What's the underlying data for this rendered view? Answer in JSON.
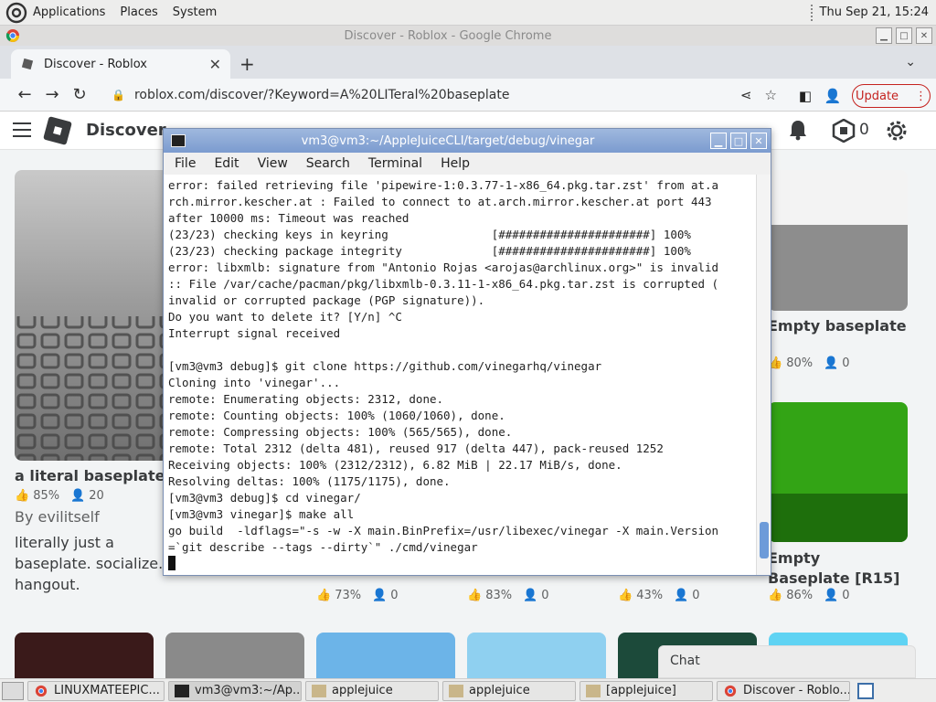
{
  "top_panel": {
    "menus": [
      "Applications",
      "Places",
      "System"
    ],
    "clock": "Thu Sep 21, 15:24"
  },
  "chrome": {
    "window_title": "Discover - Roblox - Google Chrome",
    "tab_title": "Discover - Roblox",
    "url": "roblox.com/discover/?Keyword=A%20LITeral%20baseplate",
    "update_label": "Update"
  },
  "roblox": {
    "header_title": "Discover",
    "robux_count": "0",
    "cards": [
      {
        "title": "a literal baseplate.",
        "likes": "85%",
        "players": "20",
        "creator": "By evilitself",
        "description": "literally just a baseplate. socialize. hangout."
      },
      {
        "title": "Empty baseplate",
        "likes": "80%",
        "players": "0"
      },
      {
        "title": "Empty Baseplate [R15]",
        "likes": "86%",
        "players": "0"
      }
    ],
    "row_stats": [
      {
        "likes": "73%",
        "players": "0"
      },
      {
        "likes": "83%",
        "players": "0"
      },
      {
        "likes": "43%",
        "players": "0"
      }
    ],
    "chat_label": "Chat"
  },
  "terminal": {
    "title": "vm3@vm3:~/AppleJuiceCLI/target/debug/vinegar",
    "menus": [
      "File",
      "Edit",
      "View",
      "Search",
      "Terminal",
      "Help"
    ],
    "lines": [
      "error: failed retrieving file 'pipewire-1:0.3.77-1-x86_64.pkg.tar.zst' from at.a",
      "rch.mirror.kescher.at : Failed to connect to at.arch.mirror.kescher.at port 443",
      "after 10000 ms: Timeout was reached",
      "(23/23) checking keys in keyring               [######################] 100%",
      "(23/23) checking package integrity             [######################] 100%",
      "error: libxmlb: signature from \"Antonio Rojas <arojas@archlinux.org>\" is invalid",
      ":: File /var/cache/pacman/pkg/libxmlb-0.3.11-1-x86_64.pkg.tar.zst is corrupted (",
      "invalid or corrupted package (PGP signature)).",
      "Do you want to delete it? [Y/n] ^C",
      "Interrupt signal received",
      "",
      "[vm3@vm3 debug]$ git clone https://github.com/vinegarhq/vinegar",
      "Cloning into 'vinegar'...",
      "remote: Enumerating objects: 2312, done.",
      "remote: Counting objects: 100% (1060/1060), done.",
      "remote: Compressing objects: 100% (565/565), done.",
      "remote: Total 2312 (delta 481), reused 917 (delta 447), pack-reused 1252",
      "Receiving objects: 100% (2312/2312), 6.82 MiB | 22.17 MiB/s, done.",
      "Resolving deltas: 100% (1175/1175), done.",
      "[vm3@vm3 debug]$ cd vinegar/",
      "[vm3@vm3 vinegar]$ make all",
      "go build  -ldflags=\"-s -w -X main.BinPrefix=/usr/libexec/vinegar -X main.Version",
      "=`git describe --tags --dirty`\" ./cmd/vinegar"
    ]
  },
  "taskbar": {
    "items": [
      "LINUXMATEEPIC...",
      "vm3@vm3:~/Ap...",
      "applejuice",
      "applejuice",
      "[applejuice]",
      "Discover - Roblo..."
    ]
  }
}
